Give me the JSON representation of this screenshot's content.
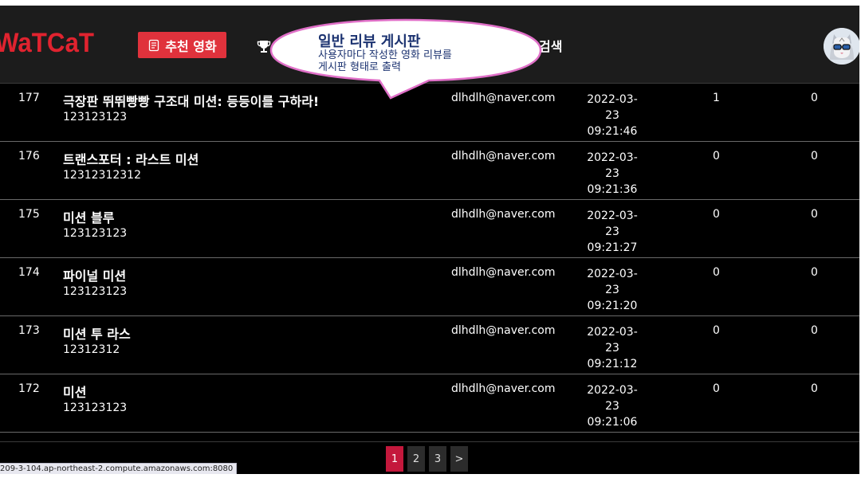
{
  "nav": {
    "logo": "WaTCaT",
    "recommend_label": "추천 영화",
    "search_label": "검색"
  },
  "callout": {
    "title": "일반 리뷰 게시판",
    "line1": "사용자마다 작성한 영화 리뷰를",
    "line2": "게시판 형태로 출력"
  },
  "reviews": [
    {
      "no": "177",
      "title": "극장판 뛰뛰빵빵 구조대 미션: 등등이를 구하라!",
      "content": "123123123",
      "email": "dlhdlh@naver.com",
      "date": "2022-03-23",
      "time": "09:21:46",
      "likes": "1",
      "comments": "0"
    },
    {
      "no": "176",
      "title": "트랜스포터 : 라스트 미션",
      "content": "12312312312",
      "email": "dlhdlh@naver.com",
      "date": "2022-03-23",
      "time": "09:21:36",
      "likes": "0",
      "comments": "0"
    },
    {
      "no": "175",
      "title": "미션 블루",
      "content": "123123123",
      "email": "dlhdlh@naver.com",
      "date": "2022-03-23",
      "time": "09:21:27",
      "likes": "0",
      "comments": "0"
    },
    {
      "no": "174",
      "title": "파이널 미션",
      "content": "123123123",
      "email": "dlhdlh@naver.com",
      "date": "2022-03-23",
      "time": "09:21:20",
      "likes": "0",
      "comments": "0"
    },
    {
      "no": "173",
      "title": "미션 투 라스",
      "content": "12312312",
      "email": "dlhdlh@naver.com",
      "date": "2022-03-23",
      "time": "09:21:12",
      "likes": "0",
      "comments": "0"
    },
    {
      "no": "172",
      "title": "미션",
      "content": "123123123",
      "email": "dlhdlh@naver.com",
      "date": "2022-03-23",
      "time": "09:21:06",
      "likes": "0",
      "comments": "0"
    }
  ],
  "pagination": {
    "pages": [
      "1",
      "2",
      "3"
    ],
    "next": ">",
    "active": "1"
  },
  "status_url": "209-3-104.ap-northeast-2.compute.amazonaws.com:8080",
  "colors": {
    "brand": "#e0232f",
    "active_page": "#c4183c",
    "callout_border": "#e070c8"
  }
}
